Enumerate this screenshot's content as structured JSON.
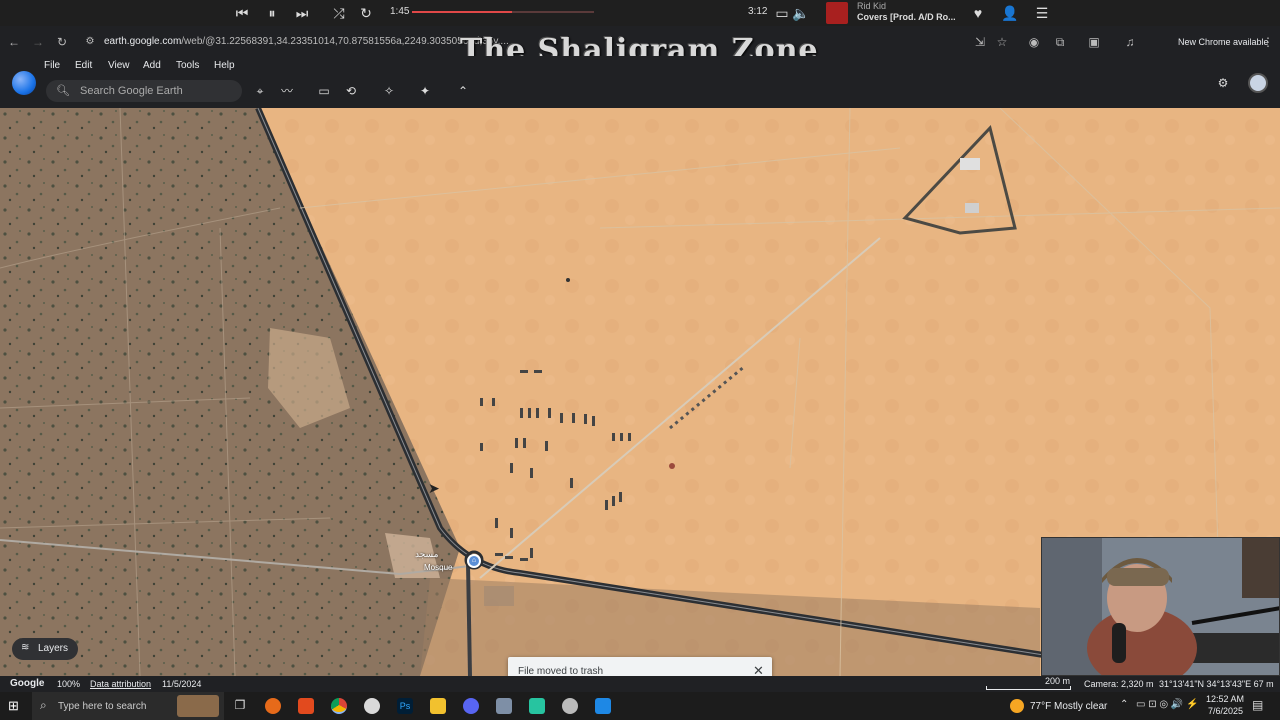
{
  "media_player": {
    "elapsed": "1:45",
    "total": "3:12",
    "progress_fraction": 0.55,
    "artist": "Rid Kid",
    "track": "Covers [Prod. A/D Ro..."
  },
  "browser": {
    "url_host": "earth.google.com",
    "url_path": "/web/@31.22568391,34.23351014,70.87581556a,2249.30350561d,35y,...",
    "new_chrome_label": "New Chrome available"
  },
  "watermark": "The Shaligram Zone",
  "app": {
    "menu": [
      "File",
      "Edit",
      "View",
      "Add",
      "Tools",
      "Help"
    ],
    "search_placeholder": "Search Google Earth"
  },
  "map": {
    "poi_label_arabic": "مسجد",
    "poi_label": "Mosque",
    "layers_label": "Layers"
  },
  "toast": {
    "message": "File moved to trash"
  },
  "status": {
    "brand": "Google",
    "zoom": "100%",
    "attribution": "Data attribution",
    "imagery_date": "11/5/2024",
    "scale": "200 m",
    "camera": "Camera: 2,320 m",
    "coords": "31°13'41\"N 34°13'43\"E 67 m"
  },
  "taskbar": {
    "search_placeholder": "Type here to search",
    "weather": "77°F  Mostly clear",
    "time": "12:52 AM",
    "date": "7/6/2025"
  },
  "colors": {
    "accent": "#1a73e8",
    "progress": "#e04848",
    "desert": "#e8b582",
    "farmland": "#8c7560"
  }
}
